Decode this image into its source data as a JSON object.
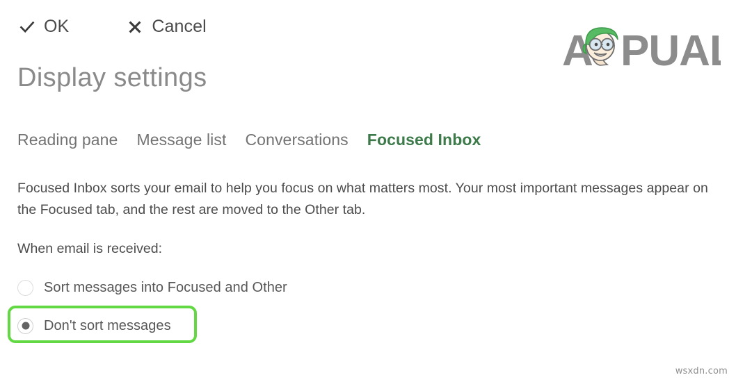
{
  "command_bar": {
    "ok": {
      "label": "OK",
      "icon": "check-icon"
    },
    "cancel": {
      "label": "Cancel",
      "icon": "close-icon"
    }
  },
  "page_title": "Display settings",
  "tabs": [
    {
      "label": "Reading pane",
      "active": false
    },
    {
      "label": "Message list",
      "active": false
    },
    {
      "label": "Conversations",
      "active": false
    },
    {
      "label": "Focused Inbox",
      "active": true
    }
  ],
  "description": "Focused Inbox sorts your email to help you focus on what matters most. Your most important messages appear on the Focused tab, and the rest are moved to the Other tab.",
  "section_label": "When email is received:",
  "radio_options": [
    {
      "label": "Sort messages into Focused and Other",
      "selected": false
    },
    {
      "label": "Don't sort messages",
      "selected": true
    }
  ],
  "annotation": {
    "type": "highlight-box",
    "color": "#62d943",
    "target": "Don't sort messages"
  },
  "logo": {
    "text_left": "A",
    "text_right": "PUALS",
    "full_text": "APPUALS",
    "text_color": "#8c8c8c",
    "hair_color": "#57bb63"
  },
  "watermark": "wsxdn.com",
  "colors": {
    "active_tab": "#3d7a4a",
    "highlight": "#62d943",
    "body_text": "#4c4c4c",
    "title": "#8a8a8a",
    "background": "#ffffff"
  }
}
